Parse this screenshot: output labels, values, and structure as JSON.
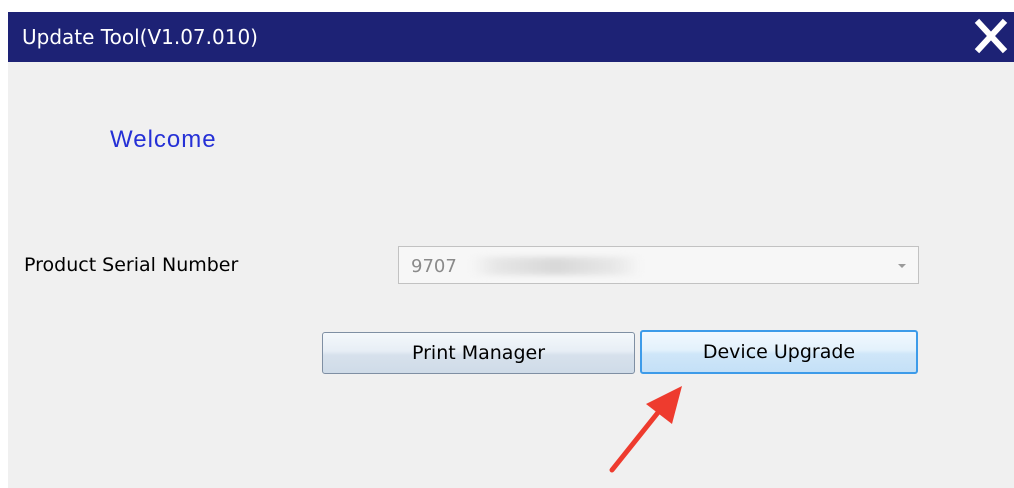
{
  "window": {
    "title": "Update Tool(V1.07.010)"
  },
  "main": {
    "welcome": "Welcome",
    "serial_label": "Product Serial Number",
    "serial_value": "9707",
    "serial_value_obscured": true
  },
  "buttons": {
    "print_manager": "Print Manager",
    "device_upgrade": "Device Upgrade"
  },
  "annotation": {
    "arrow_color": "#ee3b2e",
    "points_to": "Device Upgrade"
  },
  "colors": {
    "titlebar": "#1d2275",
    "welcome_text": "#2530d6",
    "focus_border": "#3d9be9"
  },
  "icons": {
    "close": "close-icon",
    "dropdown": "chevron-down-icon"
  }
}
